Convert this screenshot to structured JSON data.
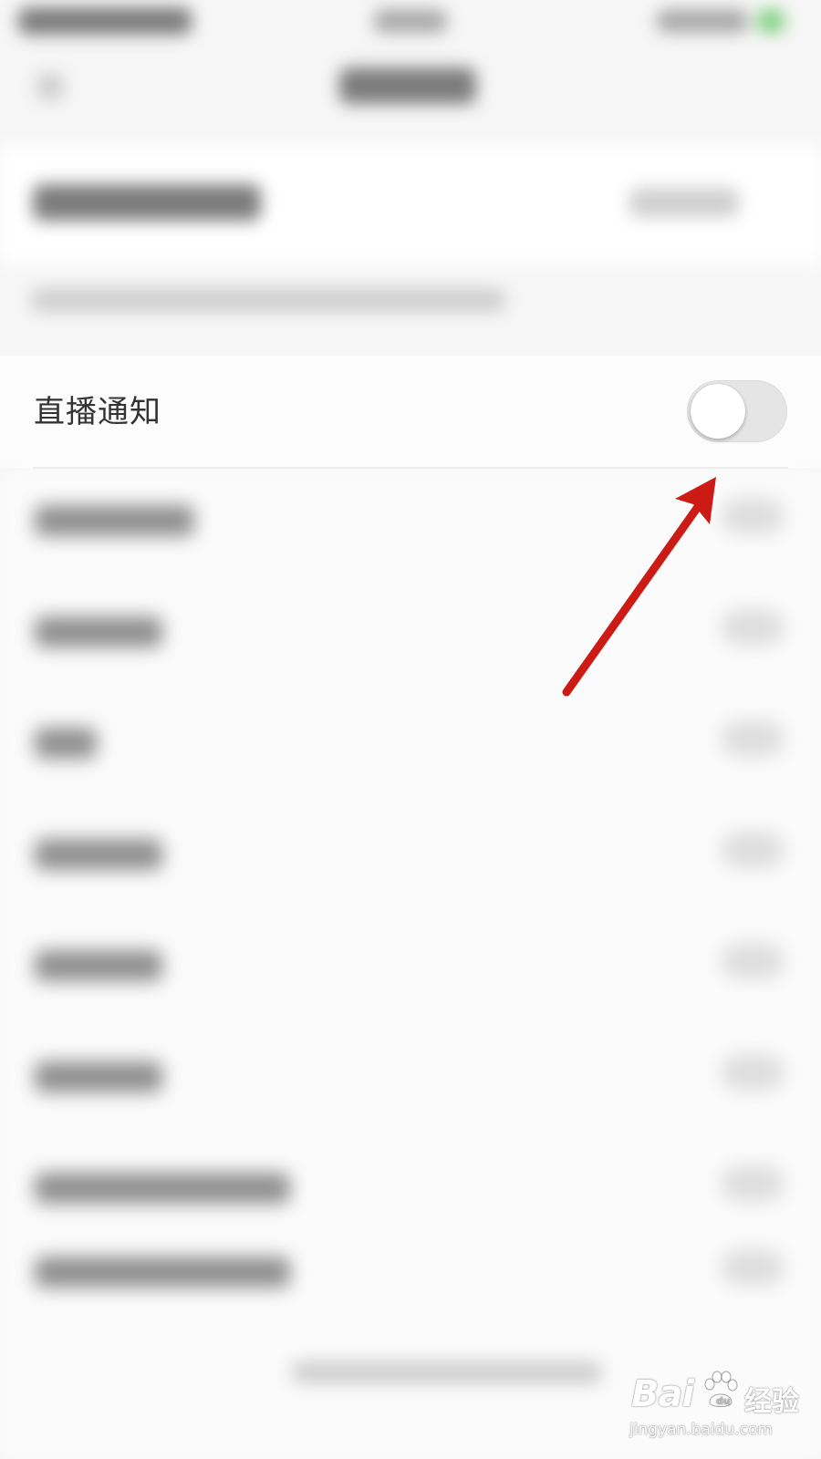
{
  "notification": {
    "label": "直播通知",
    "toggle_state": "off"
  },
  "watermark": {
    "brand": "Bai",
    "brand_suffix": "经验",
    "url": "jingyan.baidu.com"
  },
  "colors": {
    "annotation_arrow": "#cc1a14",
    "toggle_track_off": "#e5e5e5",
    "label_text": "#333333"
  }
}
